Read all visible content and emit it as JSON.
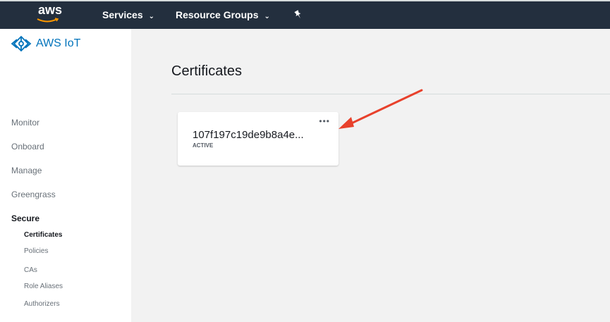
{
  "topbar": {
    "logo_text": "aws",
    "services_label": "Services",
    "resource_groups_label": "Resource Groups",
    "chevron_icon": "chevron-down-icon",
    "pin_icon": "pushpin-icon"
  },
  "sidebar": {
    "brand": "AWS IoT",
    "brand_icon": "aws-iot-icon",
    "items": [
      "Monitor",
      "Onboard",
      "Manage",
      "Greengrass"
    ],
    "section": "Secure",
    "sub_items": [
      "Certificates",
      "Policies",
      "CAs",
      "Role Aliases",
      "Authorizers"
    ],
    "active_sub_item": "Certificates"
  },
  "main": {
    "title": "Certificates",
    "card": {
      "menu_glyph": "•••",
      "id": "107f197c19de9b8a4e...",
      "status": "ACTIVE"
    }
  },
  "colors": {
    "topbar": "#232f3e",
    "link": "#0073bb",
    "arrow": "#e8412c",
    "background": "#f2f2f2"
  }
}
